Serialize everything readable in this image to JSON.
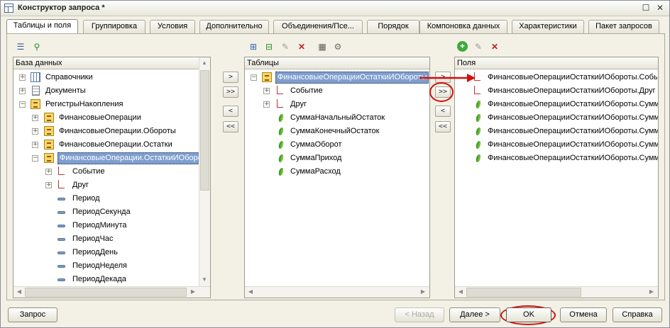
{
  "window": {
    "title": "Конструктор запроса *",
    "maximize_glyph": "☐",
    "close_glyph": "✕"
  },
  "tabs": [
    "Таблицы и поля",
    "Группировка",
    "Условия",
    "Дополнительно",
    "Объединения/Псе...",
    "Порядок",
    "Компоновка данных",
    "Характеристики",
    "Пакет запросов"
  ],
  "database_panel": {
    "header": "База данных",
    "rows": [
      {
        "label": "Справочники",
        "expander": "+",
        "icon": "table-icon"
      },
      {
        "label": "Документы",
        "expander": "+",
        "icon": "document-icon"
      },
      {
        "label": "РегистрыНакопления",
        "expander": "−",
        "icon": "register-icon"
      },
      {
        "label": "ФинансовыеОперации",
        "expander": "+",
        "icon": "register-icon"
      },
      {
        "label": "ФинансовыеОперации.Обороты",
        "expander": "+",
        "icon": "register-icon"
      },
      {
        "label": "ФинансовыеОперации.Остатки",
        "expander": "+",
        "icon": "register-icon"
      },
      {
        "label": "ФинансовыеОперации.ОстаткиИОбороты",
        "expander": "−",
        "icon": "register-icon",
        "selected": true
      },
      {
        "label": "Событие",
        "expander": "+",
        "icon": "dimension-icon"
      },
      {
        "label": "Друг",
        "expander": "+",
        "icon": "dimension-icon"
      },
      {
        "label": "Период",
        "icon": "attribute-icon"
      },
      {
        "label": "ПериодСекунда",
        "icon": "attribute-icon"
      },
      {
        "label": "ПериодМинута",
        "icon": "attribute-icon"
      },
      {
        "label": "ПериодЧас",
        "icon": "attribute-icon"
      },
      {
        "label": "ПериодДень",
        "icon": "attribute-icon"
      },
      {
        "label": "ПериодНеделя",
        "icon": "attribute-icon"
      },
      {
        "label": "ПериодДекада",
        "icon": "attribute-icon"
      }
    ]
  },
  "tables_panel": {
    "header": "Таблицы",
    "rows": [
      {
        "label": "ФинансовыеОперацииОстаткиИОбороты",
        "expander": "−",
        "icon": "register-icon",
        "selected": true
      },
      {
        "label": "Событие",
        "expander": "+",
        "icon": "dimension-icon"
      },
      {
        "label": "Друг",
        "expander": "+",
        "icon": "dimension-icon"
      },
      {
        "label": "СуммаНачальныйОстаток",
        "icon": "resource-icon"
      },
      {
        "label": "СуммаКонечныйОстаток",
        "icon": "resource-icon"
      },
      {
        "label": "СуммаОборот",
        "icon": "resource-icon"
      },
      {
        "label": "СуммаПриход",
        "icon": "resource-icon"
      },
      {
        "label": "СуммаРасход",
        "icon": "resource-icon"
      }
    ]
  },
  "fields_panel": {
    "header": "Поля",
    "rows": [
      {
        "label": "ФинансовыеОперацииОстаткиИОбороты.Событие",
        "icon": "dimension-icon"
      },
      {
        "label": "ФинансовыеОперацииОстаткиИОбороты.Друг",
        "icon": "dimension-icon"
      },
      {
        "label": "ФинансовыеОперацииОстаткиИОбороты.СуммаНачальныйОстаток",
        "icon": "resource-icon"
      },
      {
        "label": "ФинансовыеОперацииОстаткиИОбороты.СуммаКонечныйОстаток",
        "icon": "resource-icon"
      },
      {
        "label": "ФинансовыеОперацииОстаткиИОбороты.СуммаОборот",
        "icon": "resource-icon"
      },
      {
        "label": "ФинансовыеОперацииОстаткиИОбороты.СуммаПриход",
        "icon": "resource-icon"
      },
      {
        "label": "ФинансовыеОперацииОстаткиИОбороты.СуммаРасход",
        "icon": "resource-icon"
      }
    ]
  },
  "move_buttons": {
    "add": ">",
    "add_all": ">>",
    "remove": "<",
    "remove_all": "<<"
  },
  "footer": {
    "query_button": "Запрос",
    "back_button": "< Назад",
    "next_button": "Далее >",
    "ok_button": "OK",
    "cancel_button": "Отмена",
    "help_button": "Справка"
  },
  "colors": {
    "annotation": "#d40d0d",
    "selection": "#7f9ed0"
  }
}
